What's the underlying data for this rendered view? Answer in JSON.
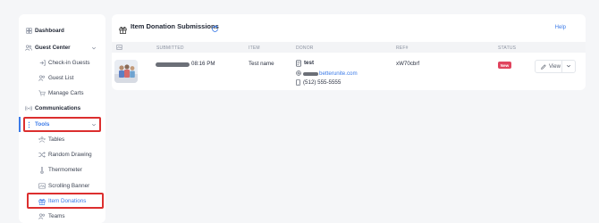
{
  "sidebar": {
    "items": [
      {
        "label": "Dashboard",
        "icon": "dashboard-icon"
      },
      {
        "label": "Guest Center",
        "icon": "users-icon"
      },
      {
        "label": "Check-in Guests",
        "icon": "check-in-icon"
      },
      {
        "label": "Guest List",
        "icon": "users-icon"
      },
      {
        "label": "Manage Carts",
        "icon": "cart-icon"
      },
      {
        "label": "Communications",
        "icon": "broadcast-icon"
      },
      {
        "label": "Tools",
        "icon": "tools-icon"
      },
      {
        "label": "Tables",
        "icon": "tables-icon"
      },
      {
        "label": "Random Drawing",
        "icon": "shuffle-icon"
      },
      {
        "label": "Thermometer",
        "icon": "thermometer-icon"
      },
      {
        "label": "Scrolling Banner",
        "icon": "banner-icon"
      },
      {
        "label": "Item Donations",
        "icon": "gift-icon"
      },
      {
        "label": "Teams",
        "icon": "users-icon"
      }
    ]
  },
  "panel": {
    "title": "Item Donation Submissions",
    "help_label": "Help",
    "columns": [
      "SUBMITTED",
      "ITEM",
      "DONOR",
      "REF#",
      "STATUS"
    ],
    "rows": [
      {
        "submitted_time": "08:16 PM",
        "item": "Test name",
        "donor_name": "test",
        "donor_email_domain": "betterunite.com",
        "donor_phone": "(512) 555-5555",
        "ref": "xW70cbrf",
        "status": "New"
      }
    ],
    "view_label": "View"
  },
  "colors": {
    "accent": "#3b7be8",
    "highlight": "#dc2f2f",
    "badge": "#e0445e"
  }
}
